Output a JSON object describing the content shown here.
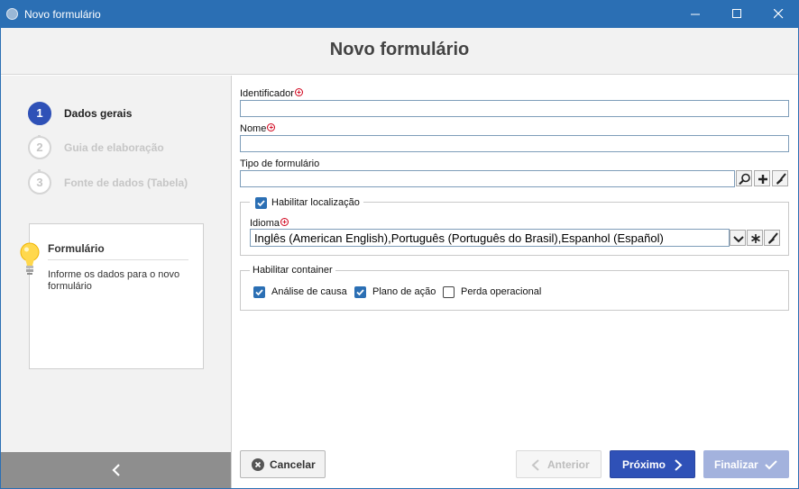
{
  "window": {
    "title": "Novo formulário",
    "controls": {
      "minimize": "minimize-icon",
      "maximize": "maximize-icon",
      "close": "close-icon"
    }
  },
  "header": {
    "title": "Novo formulário"
  },
  "steps": [
    {
      "number": "1",
      "label": "Dados gerais",
      "active": true
    },
    {
      "number": "2",
      "label": "Guia de elaboração",
      "active": false
    },
    {
      "number": "3",
      "label": "Fonte de dados (Tabela)",
      "active": false
    }
  ],
  "info": {
    "title": "Formulário",
    "text": "Informe os dados para o novo formulário",
    "icon": "lightbulb-icon"
  },
  "form": {
    "identificador": {
      "label": "Identificador",
      "value": "",
      "required": true
    },
    "nome": {
      "label": "Nome",
      "value": "",
      "required": true
    },
    "tipo": {
      "label": "Tipo de formulário",
      "value": ""
    },
    "localizacao": {
      "label": "Habilitar localização",
      "checked": true,
      "idioma": {
        "label": "Idioma",
        "value": "Inglês (American English),Português (Português do Brasil),Espanhol (Español)",
        "required": true
      }
    },
    "container": {
      "label": "Habilitar container",
      "options": [
        {
          "label": "Análise de causa",
          "checked": true
        },
        {
          "label": "Plano de ação",
          "checked": true
        },
        {
          "label": "Perda operacional",
          "checked": false
        }
      ]
    }
  },
  "buttons": {
    "cancel": "Cancelar",
    "previous": "Anterior",
    "next": "Próximo",
    "finish": "Finalizar"
  },
  "colors": {
    "titlebar": "#2b6fb4",
    "primary": "#2f51b7",
    "primary_disabled": "#a3b2dd",
    "required": "#d0021b"
  }
}
